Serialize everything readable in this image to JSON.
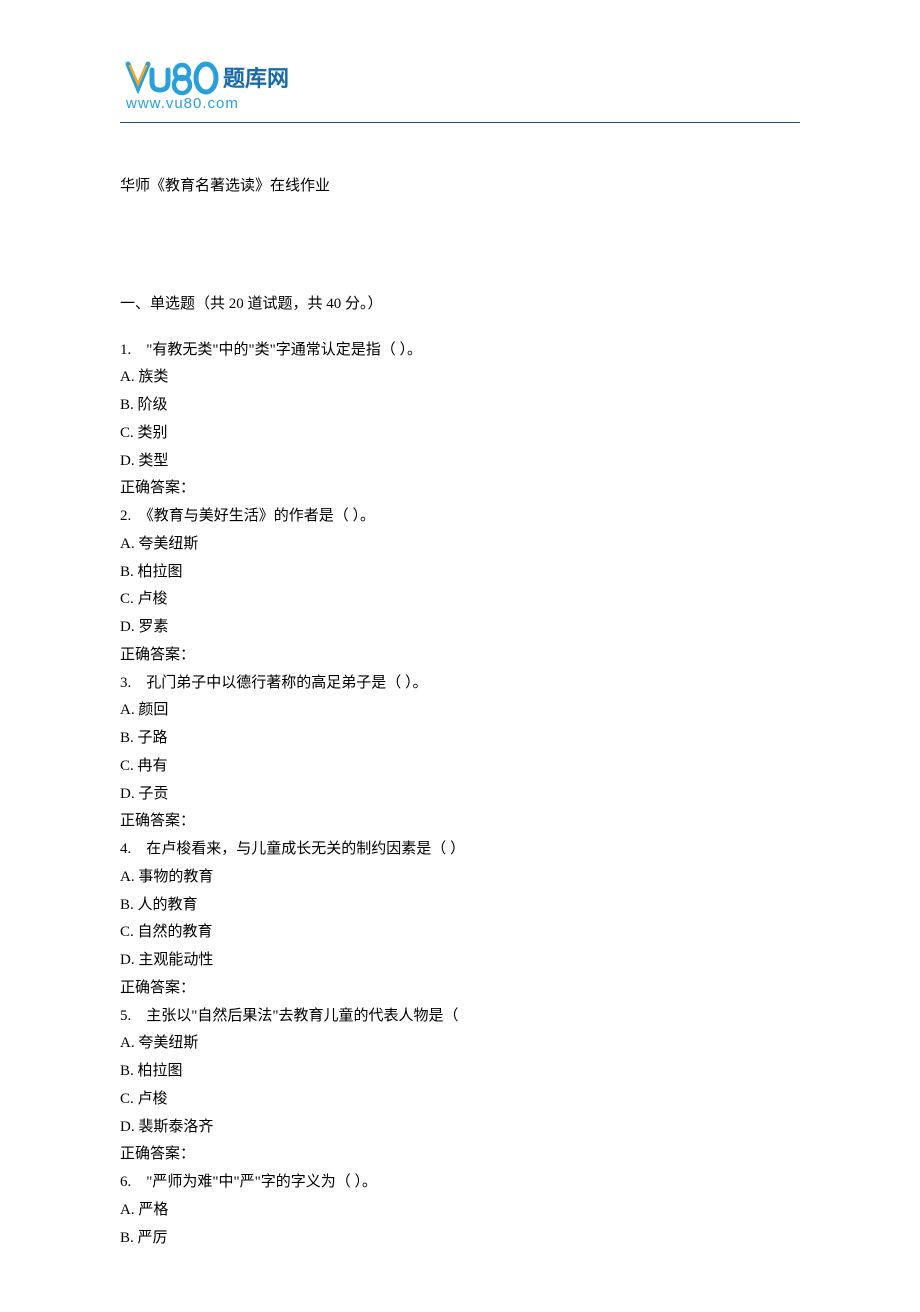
{
  "logo": {
    "brand_text": "题库网",
    "url_text": "www.vu80.com"
  },
  "title": "华师《教育名著选读》在线作业",
  "section_heading": "一、单选题（共 20 道试题，共 40 分。）",
  "questions": [
    {
      "num": "1.",
      "text": "　\"有教无类\"中的\"类\"字通常认定是指（ ）。",
      "options": [
        {
          "label": "A.",
          "text": "族类"
        },
        {
          "label": "B.",
          "text": "阶级"
        },
        {
          "label": "C.",
          "text": "类别"
        },
        {
          "label": "D.",
          "text": "类型"
        }
      ],
      "answer_label": "正确答案："
    },
    {
      "num": "2.",
      "text": "　《教育与美好生活》的作者是（ ）。",
      "options": [
        {
          "label": "A.",
          "text": "夸美纽斯"
        },
        {
          "label": "B.",
          "text": "柏拉图"
        },
        {
          "label": "C.",
          "text": "卢梭"
        },
        {
          "label": "D.",
          "text": "罗素"
        }
      ],
      "answer_label": "正确答案："
    },
    {
      "num": "3.",
      "text": "　孔门弟子中以德行著称的高足弟子是（ ）。",
      "options": [
        {
          "label": "A.",
          "text": "颜回"
        },
        {
          "label": "B.",
          "text": "子路"
        },
        {
          "label": "C.",
          "text": "冉有"
        },
        {
          "label": "D.",
          "text": "子贡"
        }
      ],
      "answer_label": "正确答案："
    },
    {
      "num": "4.",
      "text": "　在卢梭看来，与儿童成长无关的制约因素是（ ）",
      "options": [
        {
          "label": "A.",
          "text": "事物的教育"
        },
        {
          "label": "B.",
          "text": "人的教育"
        },
        {
          "label": "C.",
          "text": "自然的教育"
        },
        {
          "label": "D.",
          "text": "主观能动性"
        }
      ],
      "answer_label": "正确答案："
    },
    {
      "num": "5.",
      "text": "　主张以\"自然后果法\"去教育儿童的代表人物是（",
      "options": [
        {
          "label": "A.",
          "text": "夸美纽斯"
        },
        {
          "label": "B.",
          "text": "柏拉图"
        },
        {
          "label": "C.",
          "text": "卢梭"
        },
        {
          "label": "D.",
          "text": "裴斯泰洛齐"
        }
      ],
      "answer_label": "正确答案："
    },
    {
      "num": "6.",
      "text": "　\"严师为难\"中\"严\"字的字义为（ ）。",
      "options": [
        {
          "label": "A.",
          "text": "严格"
        },
        {
          "label": "B.",
          "text": "严厉"
        }
      ],
      "answer_label": ""
    }
  ]
}
